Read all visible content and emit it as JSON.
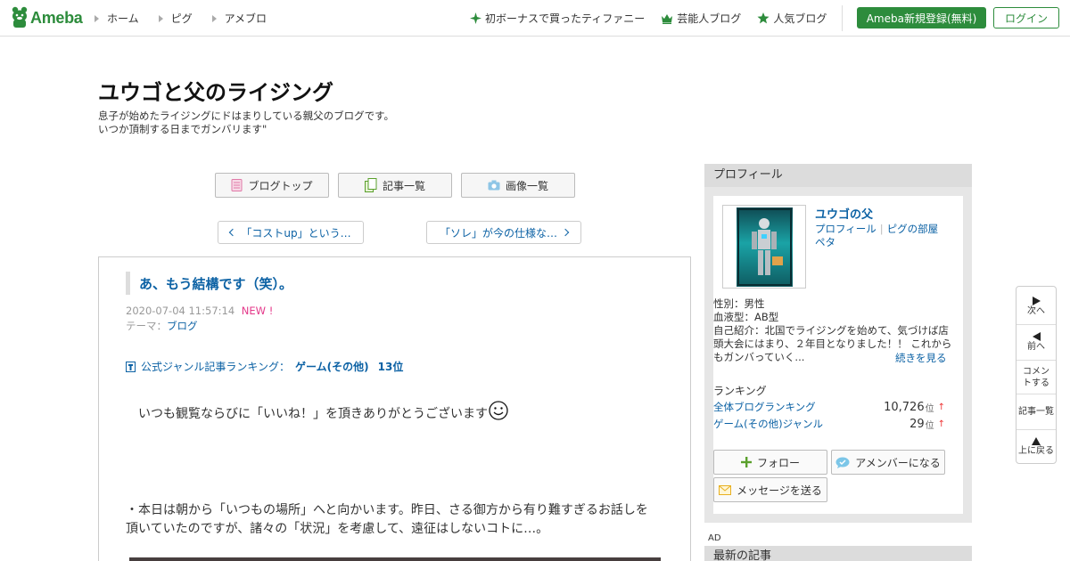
{
  "header": {
    "logo_text": "Ameba",
    "nav_left": [
      "ホーム",
      "ピグ",
      "アメブロ"
    ],
    "nav_right": [
      {
        "label": "初ボーナスで買ったティファニー",
        "icon": "sparkle-icon"
      },
      {
        "label": "芸能人ブログ",
        "icon": "crown-icon"
      },
      {
        "label": "人気ブログ",
        "icon": "star-icon"
      }
    ],
    "register_label": "Ameba新規登録(無料)",
    "login_label": "ログイン",
    "accent_color": "#2d8c3c"
  },
  "blog": {
    "title": "ユウゴと父のライジング",
    "desc_line1": "息子が始めたライジングにドはまりしている親父のブログです。",
    "desc_line2": "いつか頂制する日までガンバリます\""
  },
  "menu": {
    "top": "ブログトップ",
    "list": "記事一覧",
    "images": "画像一覧"
  },
  "pager": {
    "prev": "「コストup」という…",
    "next": "「ソレ」が今の仕様な…"
  },
  "article": {
    "title": "あ、もう結構です（笑）。",
    "date": "2020-07-04 11:57:14",
    "new_badge": "NEW !",
    "theme_label": "テーマ：",
    "theme": "ブログ",
    "ranking_label": "公式ジャンル記事ランキング：",
    "ranking_genre": "ゲーム(その他)",
    "ranking_pos": "13位",
    "body1": "いつも観覧ならびに「いいね！」を頂きありがとうございます",
    "body2": "・本日は朝から「いつもの場所」へと向かいます。昨日、さる御方から有り難すぎるお話しを頂いていたのですが、諸々の「状況」を考慮して、遠征はしないコトに…。"
  },
  "sidebar": {
    "heading": "プロフィール",
    "name": "ユウゴの父",
    "link_profile": "プロフィール",
    "link_room": "ピグの部屋",
    "link_peta": "ペタ",
    "gender": "性別：男性",
    "blood": "血液型：AB型",
    "intro": "自己紹介：北国でライジングを始めて、気づけば店頭大会にはまり、２年目となりました！！ これからもガンバっていく...",
    "more": "続きを見る",
    "ranking_heading": "ランキング",
    "rankings": [
      {
        "label": "全体ブログランキング",
        "value": "10,726",
        "unit": "位",
        "arrow": "↑"
      },
      {
        "label": "ゲーム(その他)ジャンル",
        "value": "29",
        "unit": "位",
        "arrow": "↑"
      }
    ],
    "follow": "フォロー",
    "amember": "アメンバーになる",
    "message": "メッセージを送る",
    "ad_label": "AD",
    "latest_heading": "最新の記事"
  },
  "floatnav": {
    "next": "次へ",
    "prev": "前へ",
    "comment": "コメントする",
    "list": "記事一覧",
    "top": "上に戻る"
  }
}
